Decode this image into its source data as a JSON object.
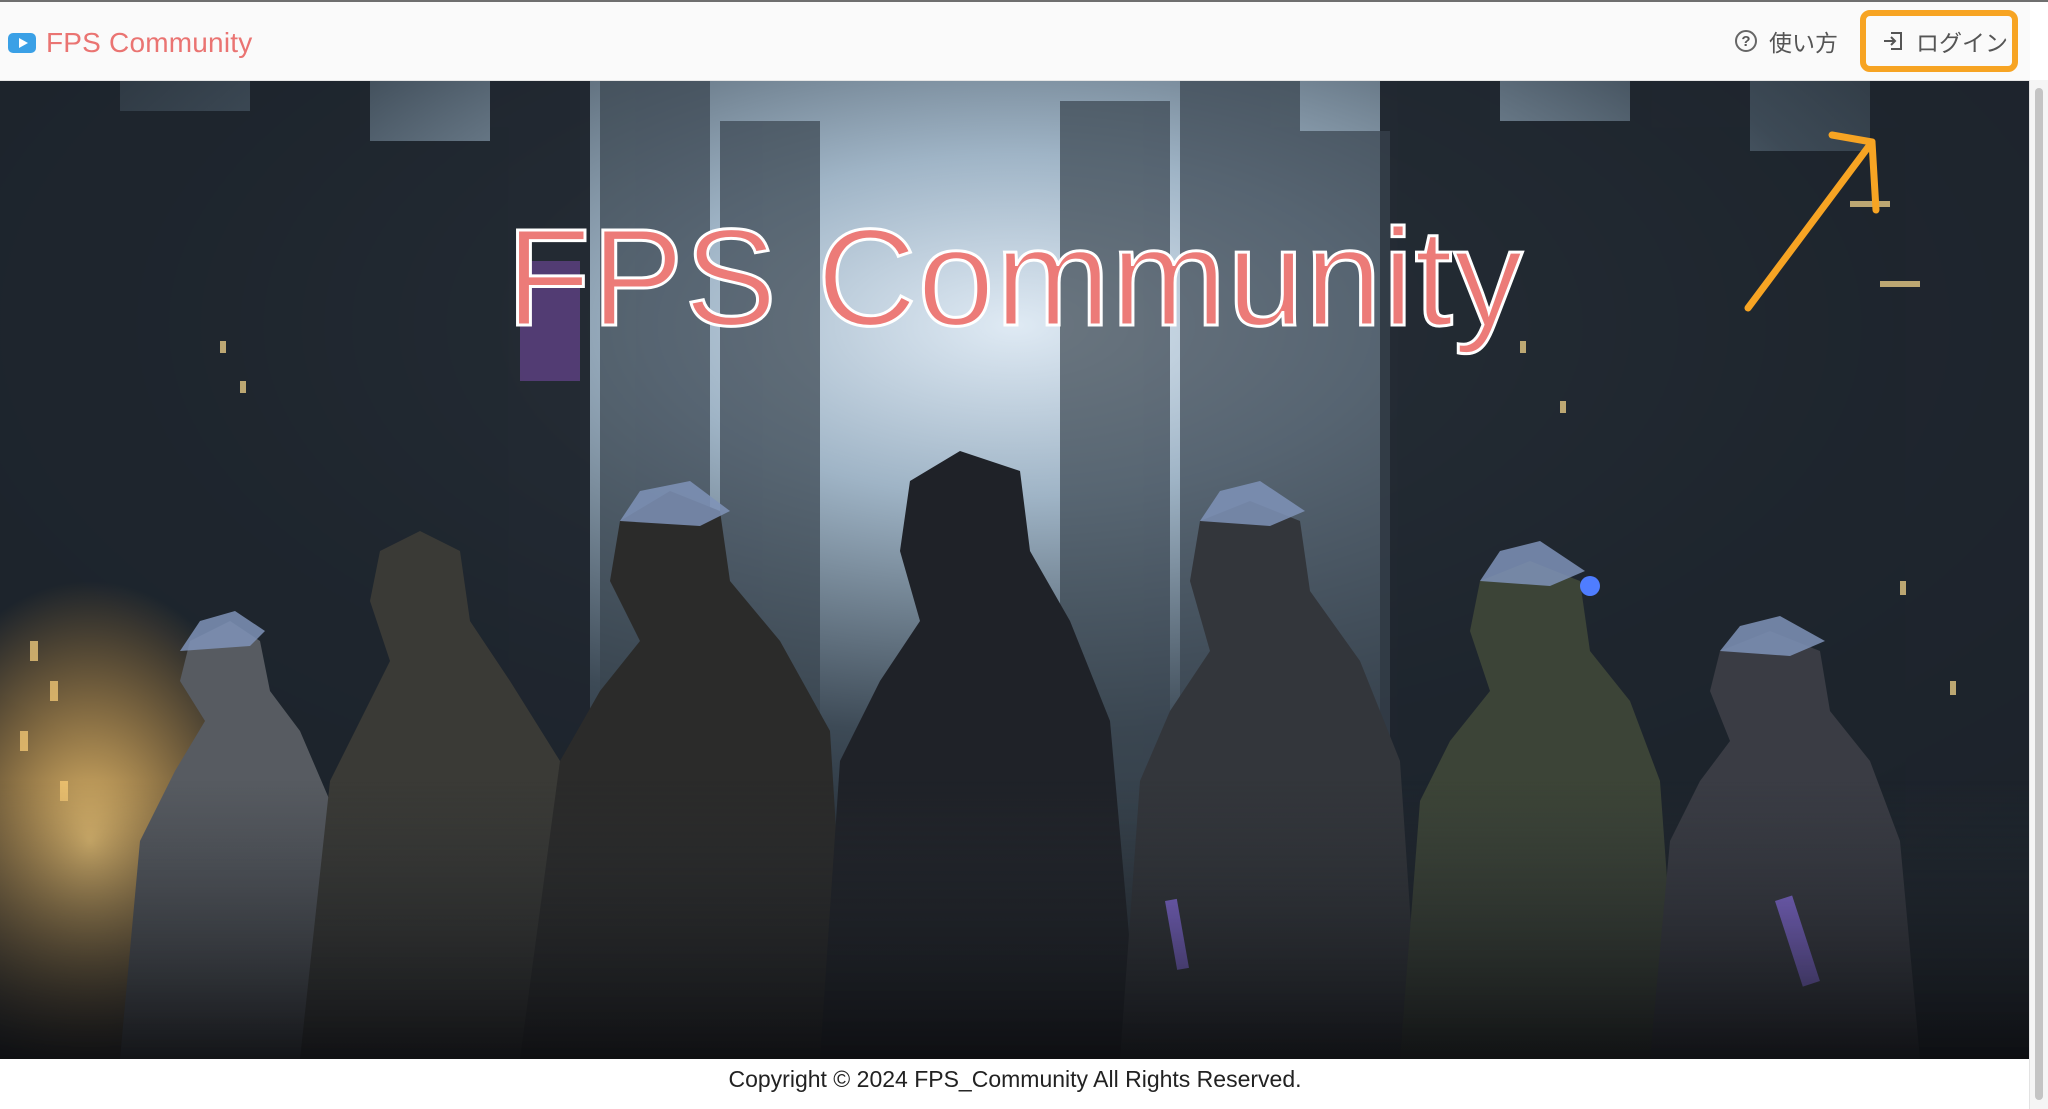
{
  "navbar": {
    "brand_icon": "video-play-icon",
    "brand_label": "FPS Community",
    "help_icon": "question-circle-icon",
    "help_label": "使い方",
    "login_icon": "sign-in-icon",
    "login_label": "ログイン"
  },
  "hero": {
    "title": "FPS Community",
    "image": "cyberpunk-squad-hero-image"
  },
  "footer": {
    "copyright": "Copyright © 2024 FPS_Community All Rights Reserved."
  },
  "colors": {
    "brand": "#ea7472",
    "hero_title": "#ec7b78",
    "annotation": "#f7a423",
    "brand_icon": "#3aa0e6"
  }
}
